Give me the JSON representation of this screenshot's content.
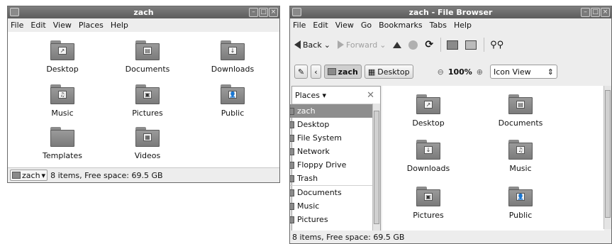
{
  "left_window": {
    "title": "zach",
    "menu": [
      "File",
      "Edit",
      "View",
      "Places",
      "Help"
    ],
    "items": [
      {
        "label": "Desktop",
        "icon": "desktop-folder-icon",
        "glyph": "↗"
      },
      {
        "label": "Documents",
        "icon": "documents-folder-icon",
        "glyph": "▤"
      },
      {
        "label": "Downloads",
        "icon": "downloads-folder-icon",
        "glyph": "↓"
      },
      {
        "label": "Music",
        "icon": "music-folder-icon",
        "glyph": "♫"
      },
      {
        "label": "Pictures",
        "icon": "pictures-folder-icon",
        "glyph": "▣"
      },
      {
        "label": "Public",
        "icon": "public-folder-icon",
        "glyph": "👤"
      },
      {
        "label": "Templates",
        "icon": "templates-folder-icon",
        "glyph": ""
      },
      {
        "label": "Videos",
        "icon": "videos-folder-icon",
        "glyph": "▦"
      }
    ],
    "status": {
      "location": "zach",
      "text": "8 items, Free space: 69.5 GB"
    }
  },
  "right_window": {
    "title": "zach - File Browser",
    "menu": [
      "File",
      "Edit",
      "View",
      "Go",
      "Bookmarks",
      "Tabs",
      "Help"
    ],
    "toolbar": {
      "back": "Back",
      "forward": "Forward"
    },
    "location": {
      "crumb_current": "zach",
      "crumb_next": "Desktop",
      "zoom": "100%",
      "view_mode": "Icon View"
    },
    "sidebar": {
      "header": "Places",
      "items": [
        {
          "label": "zach",
          "selected": true,
          "icon": "home-icon"
        },
        {
          "label": "Desktop",
          "icon": "desktop-icon"
        },
        {
          "label": "File System",
          "icon": "filesystem-icon"
        },
        {
          "label": "Network",
          "icon": "network-icon"
        },
        {
          "label": "Floppy Drive",
          "icon": "floppy-icon"
        },
        {
          "label": "Trash",
          "icon": "trash-icon"
        },
        {
          "label": "Documents",
          "icon": "documents-icon"
        },
        {
          "label": "Music",
          "icon": "music-icon"
        },
        {
          "label": "Pictures",
          "icon": "pictures-icon"
        }
      ]
    },
    "items": [
      {
        "label": "Desktop",
        "icon": "desktop-folder-icon",
        "glyph": "↗"
      },
      {
        "label": "Documents",
        "icon": "documents-folder-icon",
        "glyph": "▤"
      },
      {
        "label": "Downloads",
        "icon": "downloads-folder-icon",
        "glyph": "↓"
      },
      {
        "label": "Music",
        "icon": "music-folder-icon",
        "glyph": "♫"
      },
      {
        "label": "Pictures",
        "icon": "pictures-folder-icon",
        "glyph": "▣"
      },
      {
        "label": "Public",
        "icon": "public-folder-icon",
        "glyph": "👤"
      }
    ],
    "status": "8 items, Free space: 69.5 GB"
  }
}
